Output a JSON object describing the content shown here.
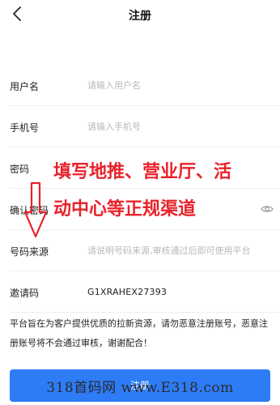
{
  "header": {
    "title": "注册"
  },
  "form": {
    "username": {
      "label": "用户名",
      "placeholder": "请输入用户名",
      "value": ""
    },
    "phone": {
      "label": "手机号",
      "placeholder": "请输入手机号",
      "value": ""
    },
    "password": {
      "label": "密码",
      "placeholder": "",
      "value": ""
    },
    "confirm": {
      "label": "确认密码",
      "placeholder": "",
      "value": ""
    },
    "source": {
      "label": "号码来源",
      "placeholder": "请说明号码来源,审核通过后即可使用平台",
      "value": ""
    },
    "invite": {
      "label": "邀请码",
      "value": "G1XRAHEX27393"
    }
  },
  "notice": {
    "text": "平台旨在为客户提供优质的拉新资源，请勿恶意注册账号，恶意注册账号将不会通过审核，谢谢配合！"
  },
  "submit": {
    "label": "注册"
  },
  "overlay": {
    "line1": "填写地推、营业厅、活",
    "line2": "动中心等正规渠道"
  },
  "watermark": {
    "text": "318首码网 www.E318.com"
  },
  "colors": {
    "accent": "#2d7cf6",
    "overlay_text": "#e8222a"
  }
}
